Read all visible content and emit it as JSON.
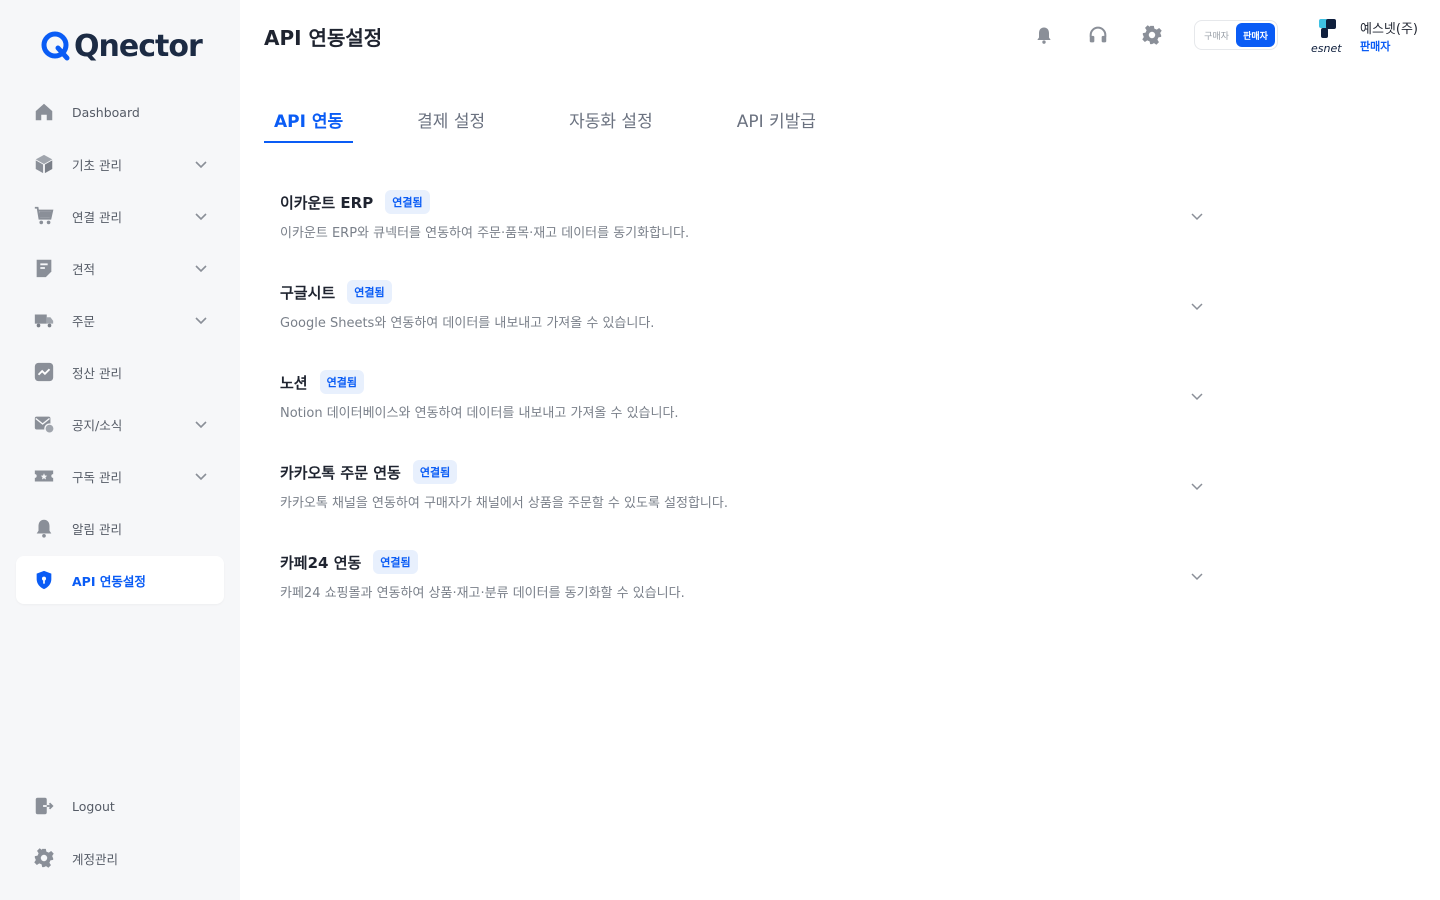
{
  "brand": {
    "name": "Qnector",
    "accent": "#0a5cf5"
  },
  "sidebar": {
    "items": [
      {
        "label": "Dashboard",
        "icon": "home-icon",
        "expandable": false,
        "active": false
      },
      {
        "label": "기초 관리",
        "icon": "cube-icon",
        "expandable": true,
        "active": false
      },
      {
        "label": "연결 관리",
        "icon": "cart-icon",
        "expandable": true,
        "active": false
      },
      {
        "label": "견적",
        "icon": "receipt-icon",
        "expandable": true,
        "active": false
      },
      {
        "label": "주문",
        "icon": "truck-icon",
        "expandable": true,
        "active": false
      },
      {
        "label": "정산 관리",
        "icon": "trend-chart-icon",
        "expandable": false,
        "active": false
      },
      {
        "label": "공지/소식",
        "icon": "mail-notice-icon",
        "expandable": true,
        "active": false
      },
      {
        "label": "구독 관리",
        "icon": "ticket-icon",
        "expandable": true,
        "active": false
      },
      {
        "label": "알림 관리",
        "icon": "bell-icon",
        "expandable": false,
        "active": false
      },
      {
        "label": "API 연동설정",
        "icon": "shield-icon",
        "expandable": false,
        "active": true
      }
    ],
    "bottom": [
      {
        "label": "Logout",
        "icon": "logout-icon"
      },
      {
        "label": "계정관리",
        "icon": "gear-icon"
      }
    ]
  },
  "header": {
    "title": "API 연동설정",
    "icons": [
      "bell-icon",
      "headset-icon",
      "gear-icon"
    ],
    "role_toggle": {
      "buyer": "구매자",
      "seller": "판매자",
      "selected": "판매자"
    },
    "company": {
      "name": "예스넷(주)",
      "role": "판매자",
      "logo_text": "esnet"
    }
  },
  "tabs": [
    {
      "label": "API 연동",
      "active": true
    },
    {
      "label": "결제 설정",
      "active": false
    },
    {
      "label": "자동화 설정",
      "active": false
    },
    {
      "label": "API 키발급",
      "active": false
    }
  ],
  "integrations": [
    {
      "title": "이카운트 ERP",
      "status": "연결됨",
      "description": "이카운트 ERP와 큐넥터를 연동하여 주문·품목·재고 데이터를 동기화합니다."
    },
    {
      "title": "구글시트",
      "status": "연결됨",
      "description": "Google Sheets와 연동하여 데이터를 내보내고 가져올 수 있습니다."
    },
    {
      "title": "노션",
      "status": "연결됨",
      "description": "Notion 데이터베이스와 연동하여 데이터를 내보내고 가져올 수 있습니다."
    },
    {
      "title": "카카오톡 주문 연동",
      "status": "연결됨",
      "description": "카카오톡 채널을 연동하여 구매자가 채널에서 상품을 주문할 수 있도록 설정합니다."
    },
    {
      "title": "카페24 연동",
      "status": "연결됨",
      "description": "카페24 쇼핑몰과 연동하여 상품·재고·분류 데이터를 동기화할 수 있습니다."
    }
  ]
}
